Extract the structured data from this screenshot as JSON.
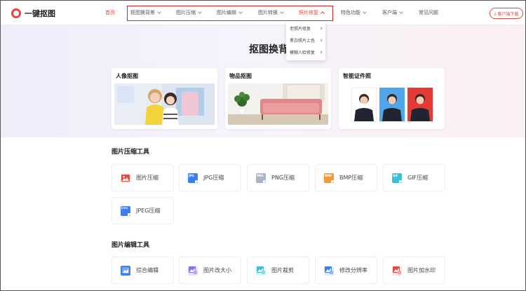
{
  "header": {
    "logo_text": "一键抠图",
    "nav": [
      {
        "label": "首页"
      },
      {
        "label": "抠图换背景"
      },
      {
        "label": "图片压缩"
      },
      {
        "label": "图片编辑"
      },
      {
        "label": "图片转换"
      },
      {
        "label": "照片修复"
      },
      {
        "label": "特色功能"
      },
      {
        "label": "客户端"
      },
      {
        "label": "常见问题"
      }
    ],
    "download_label": "客户端下载"
  },
  "dropdown": {
    "items": [
      {
        "label": "老照片修复"
      },
      {
        "label": "黑白照片上色"
      },
      {
        "label": "模糊人脸修复"
      }
    ]
  },
  "hero": {
    "title": "抠图换背",
    "cards": [
      {
        "title": "人像抠图"
      },
      {
        "title": "物品抠图"
      },
      {
        "title": "智能证件照"
      }
    ]
  },
  "sections": [
    {
      "title": "图片压缩工具",
      "tools": [
        {
          "label": "图片压缩",
          "icon": "image-icon",
          "color": "#e8463f"
        },
        {
          "label": "JPG压缩",
          "icon": "jpg-file-icon",
          "color": "#3d7ef0",
          "tag": "JPG"
        },
        {
          "label": "PNG压缩",
          "icon": "png-file-icon",
          "color": "#a9b4c6",
          "tag": "PNG"
        },
        {
          "label": "BMP压缩",
          "icon": "bmp-file-icon",
          "color": "#f29a3a",
          "tag": "BMP"
        },
        {
          "label": "GIF压缩",
          "icon": "gif-file-icon",
          "color": "#3cc0d6",
          "tag": "GIF"
        },
        {
          "label": "JPEG压缩",
          "icon": "jpeg-file-icon",
          "color": "#3d7ef0",
          "tag": "JPEG"
        }
      ]
    },
    {
      "title": "图片编辑工具",
      "tools": [
        {
          "label": "综合编辑",
          "icon": "edit-image-icon",
          "color": "#3d7ef0"
        },
        {
          "label": "图片改大小",
          "icon": "resize-icon",
          "color": "#8a6ff0"
        },
        {
          "label": "图片裁剪",
          "icon": "crop-icon",
          "color": "#3cc0d6"
        },
        {
          "label": "修改分辨率",
          "icon": "resolution-icon",
          "color": "#3d7ef0"
        },
        {
          "label": "图片加水印",
          "icon": "watermark-icon",
          "color": "#e8463f"
        }
      ]
    }
  ]
}
